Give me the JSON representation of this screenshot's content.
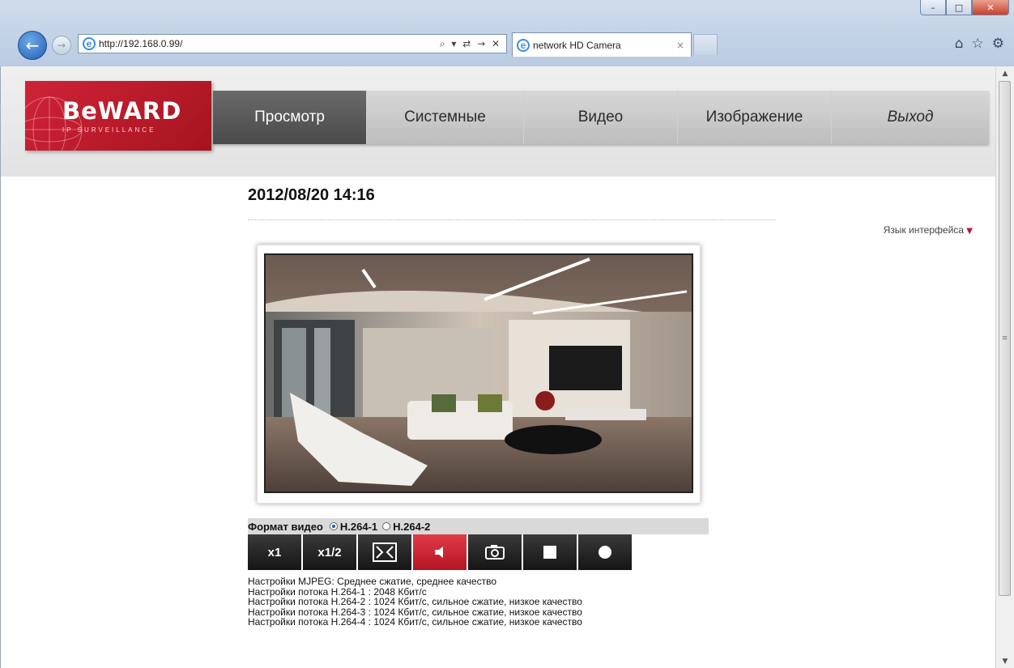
{
  "browser": {
    "url": "http://192.168.0.99/",
    "tab_title": "network HD Camera",
    "addr_tools": "⌕ ▾ ⇄ → ✕",
    "tab_close": "×",
    "window_controls": [
      "–",
      "□",
      "✕"
    ],
    "right_tools": [
      "home-icon",
      "star-icon",
      "gear-icon"
    ]
  },
  "brand": {
    "logo": "BeWARD",
    "tagline": "IP SURVEILLANCE",
    "color": "#c81f30"
  },
  "menu": [
    {
      "label": "Просмотр",
      "active": true
    },
    {
      "label": "Системные",
      "active": false
    },
    {
      "label": "Видео",
      "active": false
    },
    {
      "label": "Изображение",
      "active": false
    },
    {
      "label": "Выход",
      "active": false
    }
  ],
  "main": {
    "datetime": "2012/08/20 14:16",
    "language_link": "Язык интерфейса",
    "format_label": "Формат видео",
    "formats": [
      {
        "label": "H.264-1",
        "selected": true
      },
      {
        "label": "H.264-2",
        "selected": false
      }
    ],
    "controls": [
      {
        "name": "x1",
        "label": "x1"
      },
      {
        "name": "x1/2",
        "label": "x1/2"
      },
      {
        "name": "fit-screen-icon",
        "label": ""
      },
      {
        "name": "speaker-icon",
        "label": ""
      },
      {
        "name": "camera-snapshot-icon",
        "label": ""
      },
      {
        "name": "stop-icon",
        "label": ""
      },
      {
        "name": "record-icon",
        "label": ""
      }
    ],
    "info_lines": [
      "Настройки MJPEG: Среднее сжатие, среднее качество",
      "Настройки потока H.264-1 : 2048 Кбит/с",
      "Настройки потока H.264-2 : 1024 Кбит/с, сильное сжатие, низкое качество",
      "Настройки потока H.264-3 : 1024 Кбит/с, сильное сжатие, низкое качество",
      "Настройки потока H.264-4 : 1024 Кбит/с, сильное сжатие, низкое качество"
    ]
  }
}
